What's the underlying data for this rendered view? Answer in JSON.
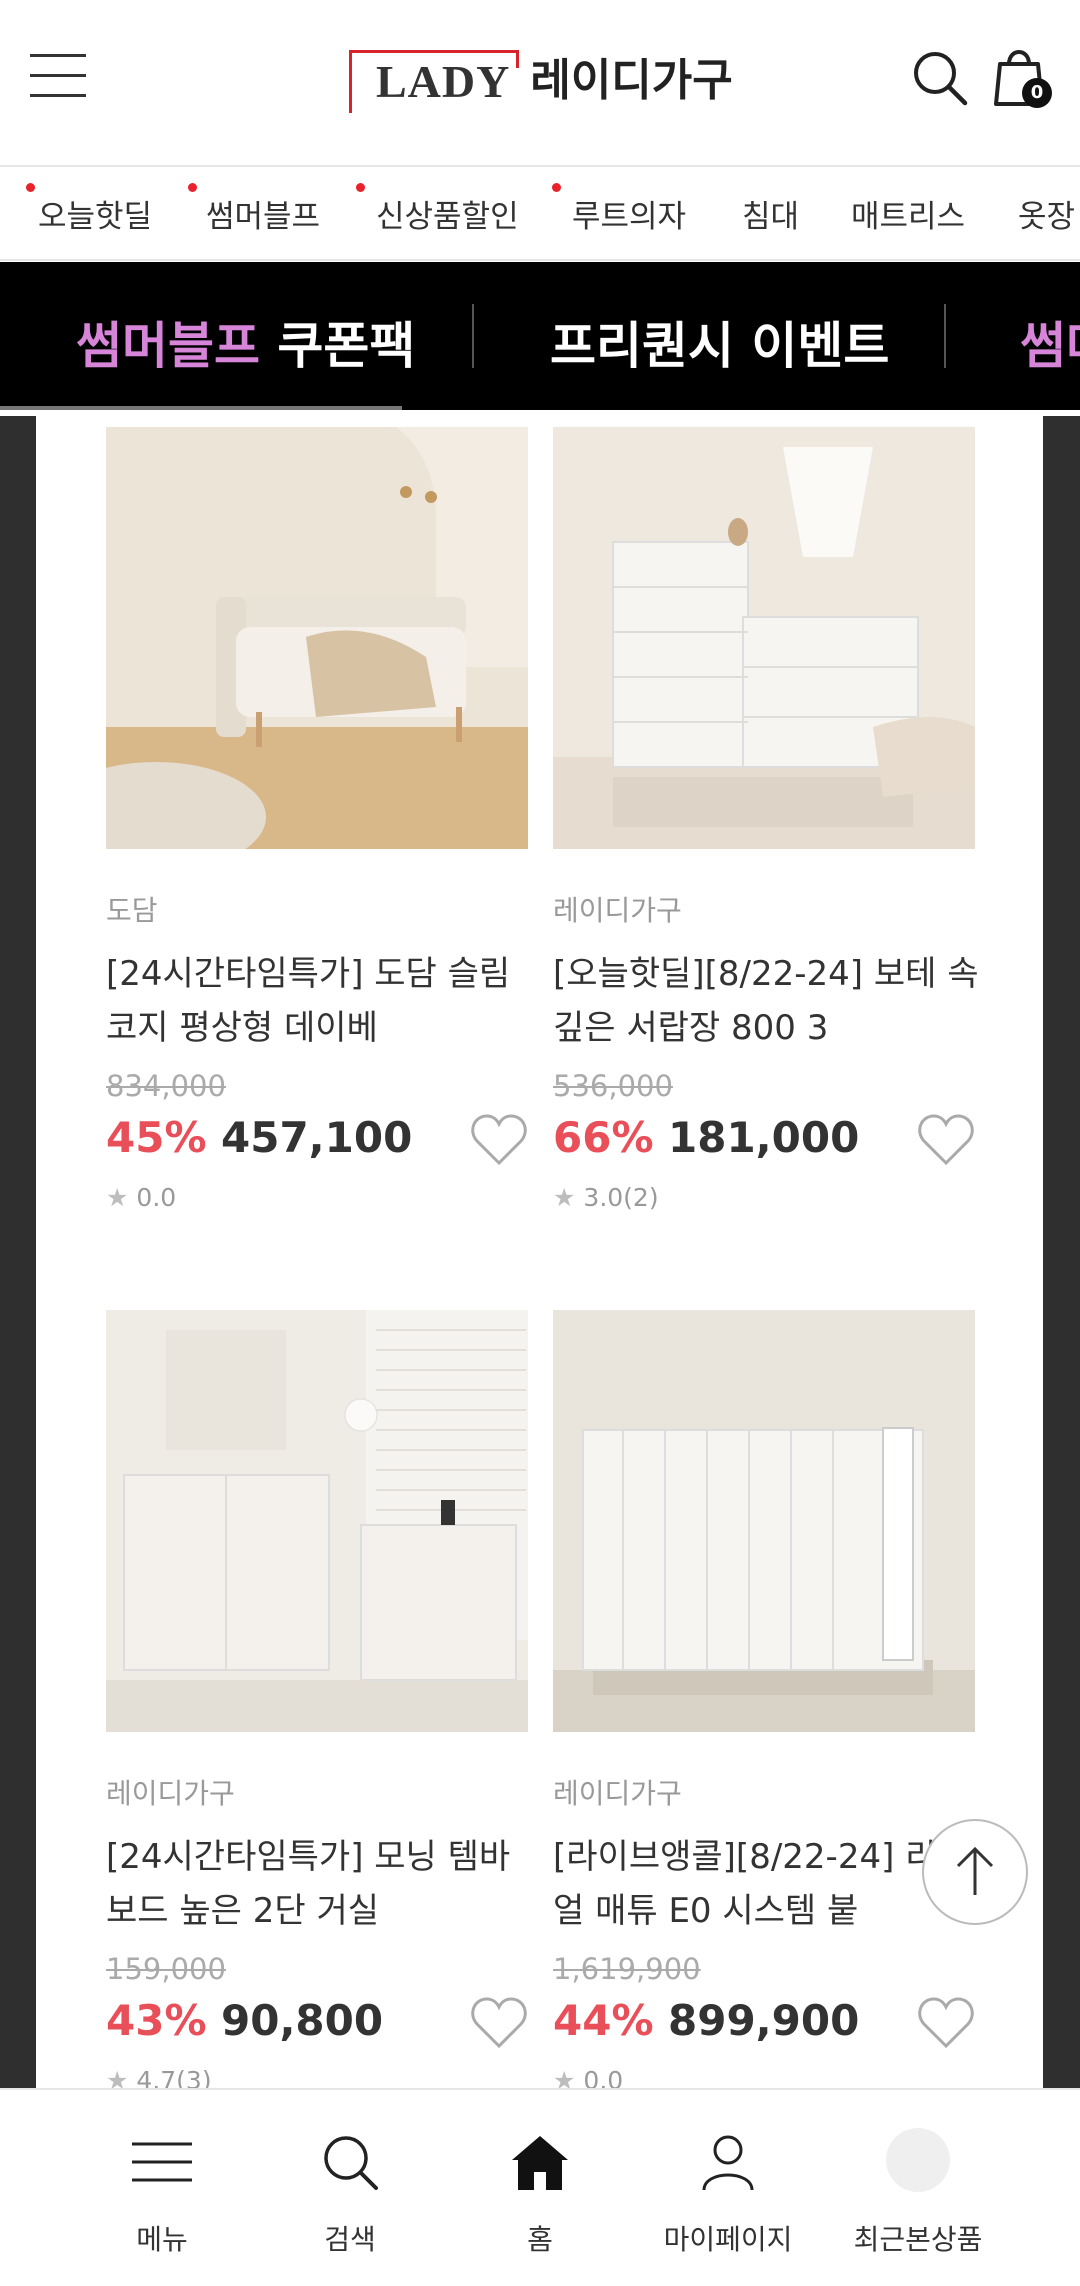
{
  "header": {
    "logo_en": "LADY",
    "logo_ko": "레이디가구",
    "cart_count": "0",
    "icons": [
      "hamburger-menu-icon",
      "search-icon",
      "shopping-bag-icon"
    ]
  },
  "categories": [
    {
      "label": "오늘핫딜",
      "dot": true
    },
    {
      "label": "썸머블프",
      "dot": true
    },
    {
      "label": "신상품할인",
      "dot": true
    },
    {
      "label": "루트의자",
      "dot": true
    },
    {
      "label": "침대",
      "dot": false
    },
    {
      "label": "매트리스",
      "dot": false
    },
    {
      "label": "옷장",
      "dot": false
    }
  ],
  "promo": {
    "item1_highlight": "썸머블프",
    "item1_rest": "쿠폰팩",
    "item2": "프리퀀시 이벤트",
    "item3_partial": "썸머"
  },
  "products": [
    {
      "brand": "도담",
      "title": "[24시간타임특가] 도담 슬림 코지 평상형 데이베",
      "original_price": "834,000",
      "discount": "45%",
      "price": "457,100",
      "rating": "0.0"
    },
    {
      "brand": "레이디가구",
      "title": "[오늘핫딜][8/22-24] 보테 속깊은 서랍장 800 3",
      "original_price": "536,000",
      "discount": "66%",
      "price": "181,000",
      "rating": "3.0(2)"
    },
    {
      "brand": "레이디가구",
      "title": "[24시간타임특가] 모닝 템바보드 높은 2단 거실",
      "original_price": "159,000",
      "discount": "43%",
      "price": "90,800",
      "rating": "4.7(3)"
    },
    {
      "brand": "레이디가구",
      "title": "[라이브앵콜][8/22-24] 리뉴얼 매튜 E0 시스템 붙",
      "original_price": "1,619,900",
      "discount": "44%",
      "price": "899,900",
      "rating": "0.0"
    }
  ],
  "bottom_nav": [
    {
      "label": "메뉴",
      "icon": "menu-icon"
    },
    {
      "label": "검색",
      "icon": "search-icon"
    },
    {
      "label": "홈",
      "icon": "home-icon"
    },
    {
      "label": "마이페이지",
      "icon": "person-icon"
    },
    {
      "label": "최근본상품",
      "icon": "recent-item-thumbnail"
    }
  ],
  "colors": {
    "discount_red": "#e94f58",
    "promo_highlight": "#d685d9",
    "brand_red": "#d8232a"
  }
}
